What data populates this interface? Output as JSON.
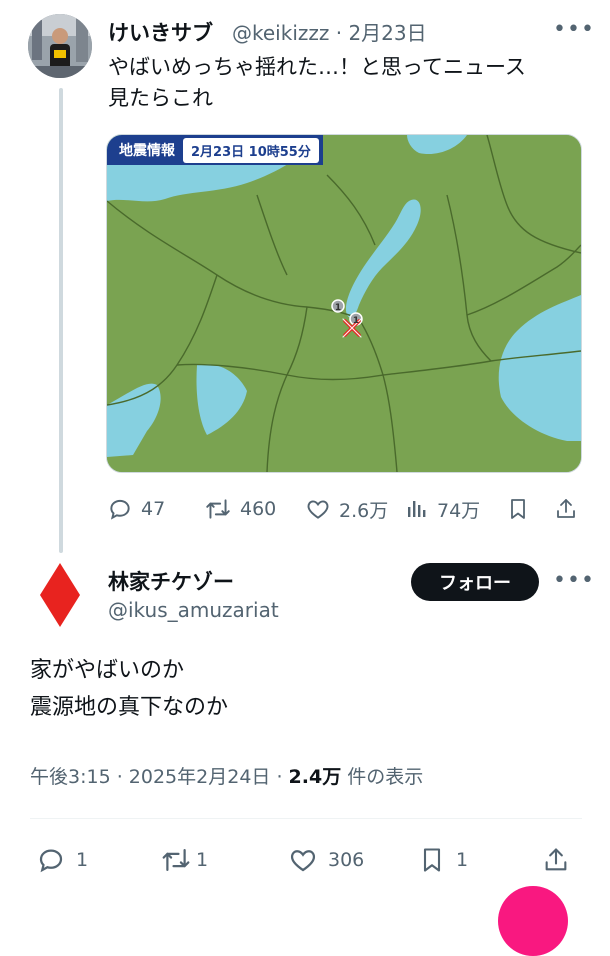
{
  "tweet1": {
    "name": "けいきサブ",
    "handle": "@keikizzz",
    "separator": "·",
    "date": "2月23日",
    "text_line1": "やばいめっちゃ揺れた…！と思ってニュース",
    "text_line2": "見たらこれ",
    "media": {
      "tag": "地震情報",
      "time": "2月23日 10時55分",
      "markers": [
        "1",
        "1"
      ]
    },
    "actions": {
      "replies": "47",
      "retweets": "460",
      "likes": "2.6万",
      "views": "74万"
    }
  },
  "reply": {
    "name": "林家チケゾー",
    "handle": "@ikus_amuzariat",
    "follow_label": "フォロー",
    "line1": "家がやばいのか",
    "line2": "震源地の真下なのか",
    "time": "午後3:15 · 2025年2月24日 · ",
    "views_count": "2.4万",
    "views_label": " 件の表示",
    "actions": {
      "replies": "1",
      "retweets": "1",
      "likes": "306",
      "bookmarks": "1"
    }
  },
  "colors": {
    "accent": "#f91880",
    "map_land": "#7aa351",
    "map_water": "#86d0e0",
    "badge": "#1d3f8e",
    "diamond": "#e8231f"
  },
  "icons": [
    "reply-icon",
    "retweet-icon",
    "like-icon",
    "views-icon",
    "bookmark-icon",
    "share-icon",
    "more-icon",
    "red-diamond-avatar"
  ]
}
